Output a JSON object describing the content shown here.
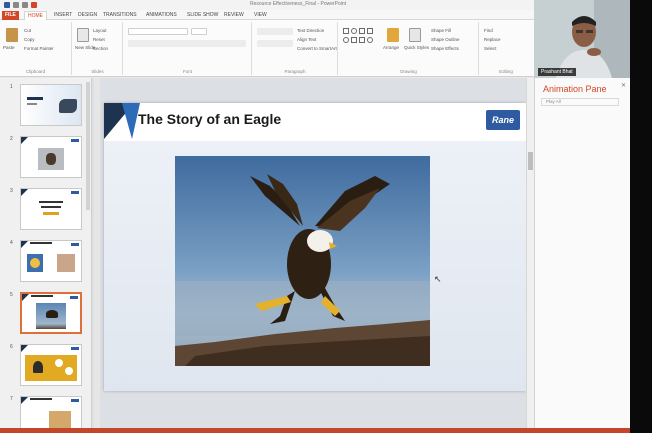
{
  "app": {
    "document_title": "Resource Effectiveness_Final - PowerPoint"
  },
  "ribbon_tabs": [
    "FILE",
    "HOME",
    "INSERT",
    "DESIGN",
    "TRANSITIONS",
    "ANIMATIONS",
    "SLIDE SHOW",
    "REVIEW",
    "VIEW"
  ],
  "ribbon": {
    "paste": "Paste",
    "cut": "Cut",
    "copy": "Copy",
    "format_painter": "Format Painter",
    "new_slide": "New Slide",
    "layout": "Layout",
    "reset": "Reset",
    "section": "Section",
    "text_direction": "Text Direction",
    "align_text": "Align Text",
    "convert_smartart": "Convert to SmartArt",
    "arrange": "Arrange",
    "quick_styles": "Quick Styles",
    "shape_fill": "Shape Fill",
    "shape_outline": "Shape Outline",
    "shape_effects": "Shape Effects",
    "find": "Find",
    "replace": "Replace",
    "select": "Select",
    "groups": [
      "Clipboard",
      "Slides",
      "Font",
      "Paragraph",
      "Drawing",
      "Editing"
    ]
  },
  "thumbnails": {
    "numbers": [
      "1",
      "2",
      "3",
      "4",
      "5",
      "6",
      "7"
    ],
    "selected_index": 5
  },
  "slide": {
    "title": "The Story of an Eagle",
    "logo_text": "Rane"
  },
  "animation_pane": {
    "title": "Animation Pane",
    "play_all": "Play All"
  },
  "webcam": {
    "name_tag": "Prashant Bhat"
  },
  "colors": {
    "accent": "#d24726",
    "slide_dark": "#1e3350",
    "slide_blue": "#2d6bb8",
    "logo": "#2d5aa0",
    "status_bar": "#c2462a"
  },
  "icons": [
    "save-icon",
    "undo-icon",
    "redo-icon",
    "paste-icon",
    "shape-icons",
    "mouse-cursor-icon",
    "close-icon"
  ]
}
